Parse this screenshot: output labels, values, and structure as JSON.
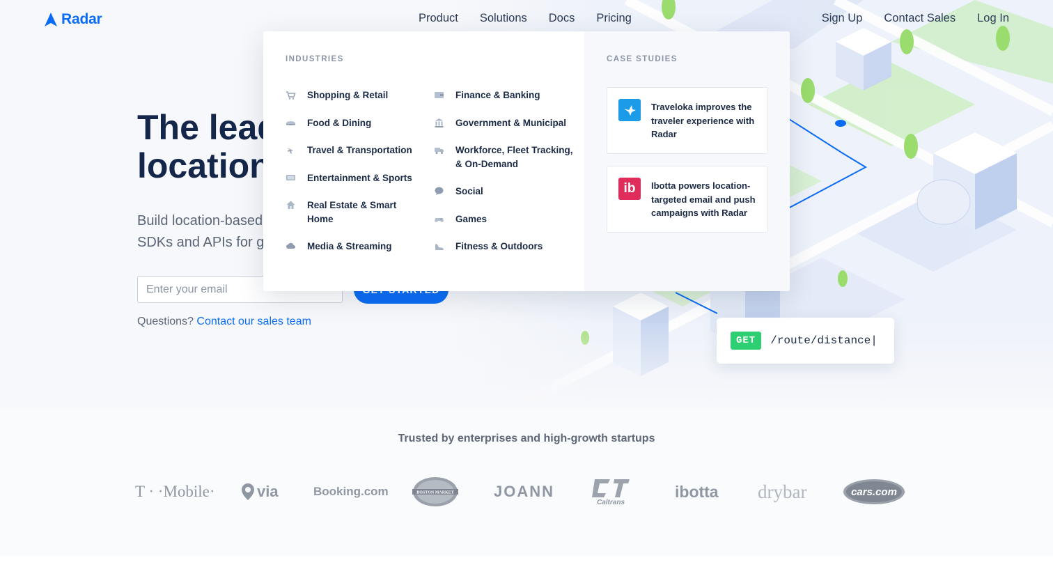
{
  "brand": {
    "name": "Radar",
    "color": "#0a6cf5"
  },
  "nav": [
    "Product",
    "Solutions",
    "Docs",
    "Pricing"
  ],
  "right_nav": [
    "Sign Up",
    "Contact Sales",
    "Log In"
  ],
  "hero": {
    "headline_line1": "The lead",
    "headline_line2": "location",
    "subhead_line1": "Build location-based",
    "subhead_line2": "SDKs and APIs for g",
    "email_placeholder": "Enter your email",
    "cta_label": "GET STARTED",
    "questions_prefix": "Questions?",
    "questions_link": "Contact our sales team"
  },
  "code_pill": {
    "method": "GET",
    "route": "/route/distance|"
  },
  "dropdown": {
    "industries_label": "INDUSTRIES",
    "case_studies_label": "CASE STUDIES",
    "col1": [
      {
        "icon": "shopping-cart-icon",
        "label": "Shopping & Retail"
      },
      {
        "icon": "food-plate-icon",
        "label": "Food & Dining"
      },
      {
        "icon": "airplane-icon",
        "label": "Travel & Transportation"
      },
      {
        "icon": "screen-icon",
        "label": "Entertainment & Sports"
      },
      {
        "icon": "house-icon",
        "label": "Real Estate & Smart Home"
      },
      {
        "icon": "cloud-icon",
        "label": "Media & Streaming"
      }
    ],
    "col2": [
      {
        "icon": "wallet-icon",
        "label": "Finance & Banking"
      },
      {
        "icon": "building-icon",
        "label": "Government & Municipal"
      },
      {
        "icon": "truck-icon",
        "label": "Workforce, Fleet Tracking, & On-Demand"
      },
      {
        "icon": "chat-icon",
        "label": "Social"
      },
      {
        "icon": "gamepad-icon",
        "label": "Games"
      },
      {
        "icon": "shoe-icon",
        "label": "Fitness & Outdoors"
      }
    ],
    "cases": [
      {
        "logo": "traveloka-logo",
        "logo_text": "",
        "text": "Traveloka improves the traveler experience with Radar"
      },
      {
        "logo": "ibotta-logo",
        "logo_text": "ib",
        "text": "Ibotta powers location-targeted email and push campaigns with Radar"
      }
    ]
  },
  "trusted": {
    "title": "Trusted by enterprises and high-growth startups",
    "logos": [
      "T · ·Mobile·",
      "via",
      "Booking.com",
      "BOSTON MARKET",
      "JOANN",
      "Caltrans",
      "ibotta",
      "drybar",
      "cars.com"
    ]
  }
}
